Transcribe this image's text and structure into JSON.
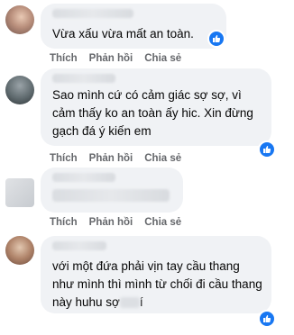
{
  "actions": {
    "like": "Thích",
    "reply": "Phản hồi",
    "share": "Chia sẻ"
  },
  "comments": [
    {
      "text": "Vừa xấu vừa mất an toàn."
    },
    {
      "text": "Sao mình cứ có cảm giác sợ sợ, vì cảm thấy ko an toàn ấy hic. Xin đừng gạch đá ý kiến em"
    },
    {
      "text": ""
    },
    {
      "text_start": "với một đứa phải vịn tay cầu thang như mình thì mình từ chối đi cầu thang này huhu sợ",
      "text_end": "í"
    }
  ],
  "colors": {
    "bubble": "#f0f2f5",
    "meta": "#65676b",
    "like_badge": "#1877f2"
  }
}
